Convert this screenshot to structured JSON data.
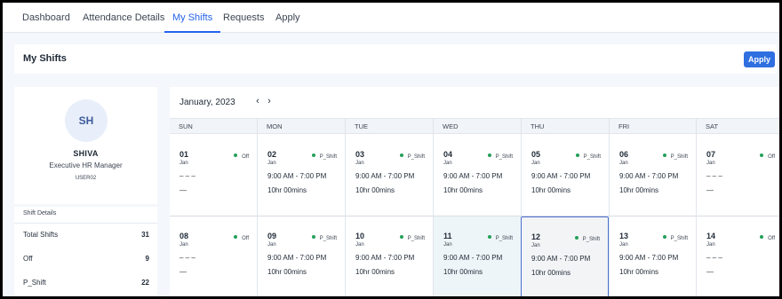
{
  "tabs": [
    {
      "label": "Dashboard",
      "active": false
    },
    {
      "label": "Attendance Details",
      "active": false
    },
    {
      "label": "My Shifts",
      "active": true
    },
    {
      "label": "Requests",
      "active": false
    },
    {
      "label": "Apply",
      "active": false
    }
  ],
  "page": {
    "title": "My Shifts",
    "apply_label": "Apply"
  },
  "colors": {
    "accent": "#2563eb",
    "button": "#2f6fe0",
    "shift_dot": "#24a05a",
    "selected_border": "#4a6fd0"
  },
  "profile": {
    "initials": "SH",
    "name": "SHIVA",
    "role": "Executive HR Manager",
    "user_id": "USER02"
  },
  "shift_details": {
    "title": "Shift Details",
    "rows": [
      {
        "label": "Total Shifts",
        "value": "31"
      },
      {
        "label": "Off",
        "value": "9"
      },
      {
        "label": "P_Shift",
        "value": "22"
      }
    ]
  },
  "calendar": {
    "month_label": "January, 2023",
    "prev_icon": "chevron-left-icon",
    "next_icon": "chevron-right-icon",
    "weekdays": [
      "SUN",
      "MON",
      "TUE",
      "WED",
      "THU",
      "FRI",
      "SAT"
    ],
    "weeks": [
      [
        {
          "day": "01",
          "month": "Jan",
          "type": "Off",
          "time": "– – –",
          "duration": "—"
        },
        {
          "day": "02",
          "month": "Jan",
          "type": "P_Shift",
          "time": "9:00 AM - 7:00 PM",
          "duration": "10hr 00mins"
        },
        {
          "day": "03",
          "month": "Jan",
          "type": "P_Shift",
          "time": "9:00 AM - 7:00 PM",
          "duration": "10hr 00mins"
        },
        {
          "day": "04",
          "month": "Jan",
          "type": "P_Shift",
          "time": "9:00 AM - 7:00 PM",
          "duration": "10hr 00mins"
        },
        {
          "day": "05",
          "month": "Jan",
          "type": "P_Shift",
          "time": "9:00 AM - 7:00 PM",
          "duration": "10hr 00mins"
        },
        {
          "day": "06",
          "month": "Jan",
          "type": "P_Shift",
          "time": "9:00 AM - 7:00 PM",
          "duration": "10hr 00mins"
        },
        {
          "day": "07",
          "month": "Jan",
          "type": "Off",
          "time": "– – –",
          "duration": "—"
        }
      ],
      [
        {
          "day": "08",
          "month": "Jan",
          "type": "Off",
          "time": "– – –",
          "duration": "—"
        },
        {
          "day": "09",
          "month": "Jan",
          "type": "P_Shift",
          "time": "9:00 AM - 7:00 PM",
          "duration": "10hr 00mins"
        },
        {
          "day": "10",
          "month": "Jan",
          "type": "P_Shift",
          "time": "9:00 AM - 7:00 PM",
          "duration": "10hr 00mins"
        },
        {
          "day": "11",
          "month": "Jan",
          "type": "P_Shift",
          "time": "9:00 AM - 7:00 PM",
          "duration": "10hr 00mins",
          "state": "today"
        },
        {
          "day": "12",
          "month": "Jan",
          "type": "P_Shift",
          "time": "9:00 AM - 7:00 PM",
          "duration": "10hr 00mins",
          "state": "selected"
        },
        {
          "day": "13",
          "month": "Jan",
          "type": "P_Shift",
          "time": "9:00 AM - 7:00 PM",
          "duration": "10hr 00mins"
        },
        {
          "day": "14",
          "month": "Jan",
          "type": "Off",
          "time": "– – –",
          "duration": "—"
        }
      ]
    ]
  }
}
